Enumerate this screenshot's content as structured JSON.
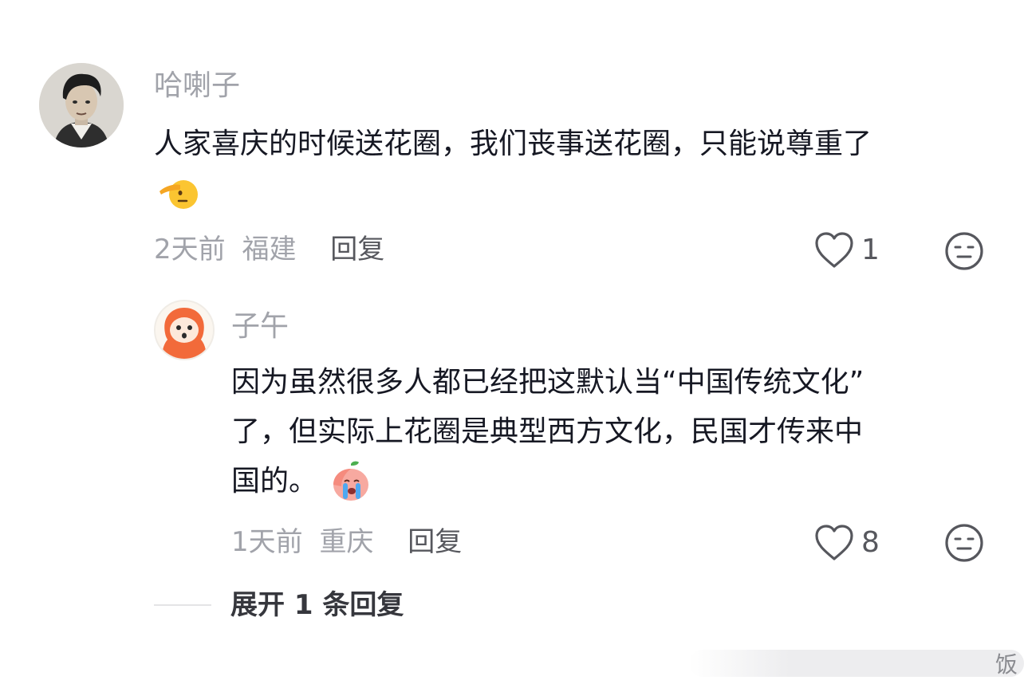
{
  "comments": [
    {
      "username": "哈喇子",
      "text": "人家喜庆的时候送花圈，我们丧事送花圈，只能说尊重了",
      "emoji": "salute-emoji",
      "time": "2天前",
      "location": "福建",
      "reply_label": "回复",
      "likes": "1"
    },
    {
      "username": "子午",
      "text_line1": "因为虽然很多人都已经把这默认当“中国传统文化”",
      "text_line2": "了，但实际上花圈是典型西方文化，民国才传来中",
      "text_line3": "国的。",
      "emoji": "crying-peach-emoji",
      "time": "1天前",
      "location": "重庆",
      "reply_label": "回复",
      "likes": "8"
    }
  ],
  "expand_label": "展开 1 条回复",
  "watermark_text": "饭",
  "colors": {
    "secondary_text": "#a1a3aa",
    "primary_text": "#161823",
    "action_text": "#56575d",
    "avatar_orange": "#f26a3a"
  }
}
